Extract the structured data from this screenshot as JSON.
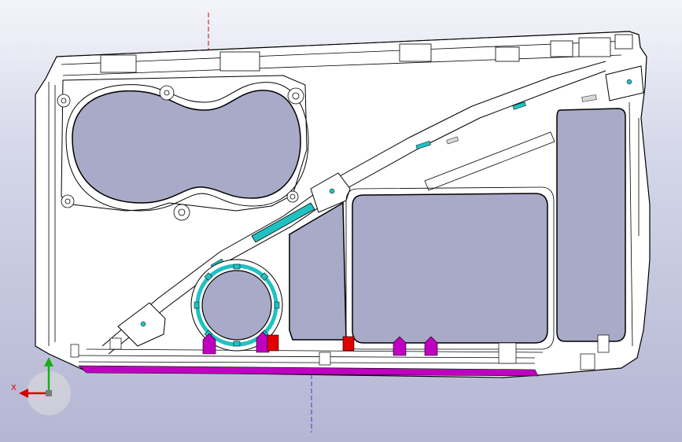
{
  "viewport": {
    "background_top": "#f4f5fa",
    "background_bottom": "#b4b6d3"
  },
  "triad": {
    "x_label": "X",
    "x_color": "#d40000",
    "y_color": "#16b016",
    "origin_color": "#7a7a7a"
  },
  "model": {
    "outline_color": "#000000",
    "fill_color": "#ffffff",
    "cutout_color": "#a9aac8",
    "accent_cyan": "#21c1c1",
    "accent_magenta": "#c000c0",
    "accent_red": "#e00000",
    "centerline_red": "#d40000",
    "centerline_blue": "#3a3ad0"
  }
}
